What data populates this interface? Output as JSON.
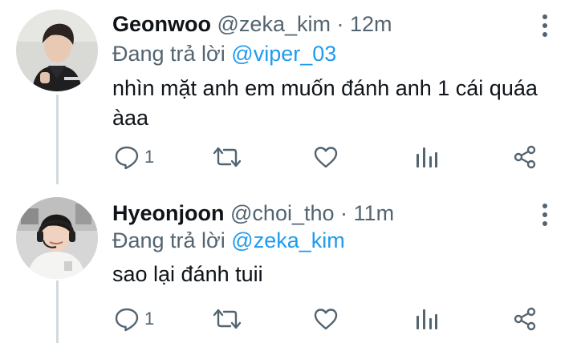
{
  "tweets": [
    {
      "name": "Geonwoo",
      "handle": "@zeka_kim",
      "separator": "·",
      "time": "12m",
      "replying_prefix": "Đang trả lời",
      "replying_to": "@viper_03",
      "text": "nhìn mặt anh em muốn đánh anh 1 cái quáa àaa",
      "reply_count": "1",
      "avatar_icon": "avatar-dark-jacket"
    },
    {
      "name": "Hyeonjoon",
      "handle": "@choi_tho",
      "separator": "·",
      "time": "11m",
      "replying_prefix": "Đang trả lời",
      "replying_to": "@zeka_kim",
      "text": "sao lại đánh tuii",
      "reply_count": "1",
      "avatar_icon": "avatar-headset-white-shirt"
    }
  ],
  "icons": {
    "reply": "reply-icon",
    "retweet": "retweet-icon",
    "like": "heart-icon",
    "analytics": "analytics-icon",
    "share": "share-icon",
    "more": "more-vertical-icon"
  },
  "colors": {
    "text": "#0f1419",
    "secondary": "#536471",
    "accent": "#1d9bf0",
    "thread_line": "#cfd9de"
  }
}
